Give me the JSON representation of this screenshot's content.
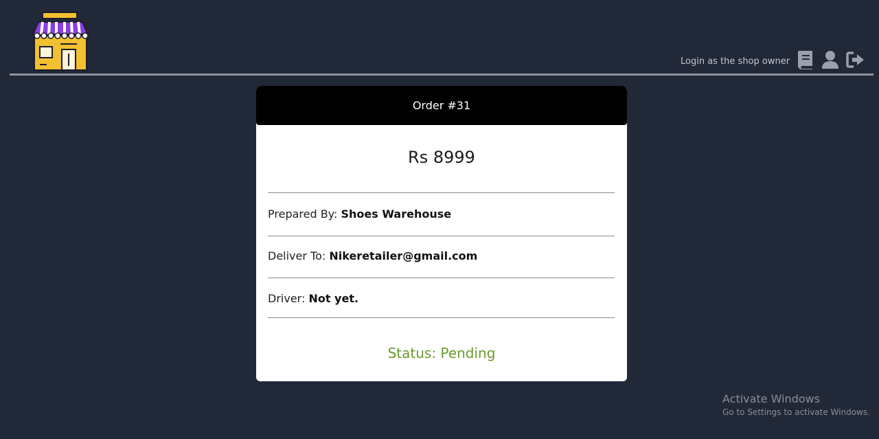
{
  "header": {
    "login_link": "Login as the shop owner",
    "icons": [
      "book-icon",
      "user-icon",
      "sign-out-icon"
    ],
    "logo": "store-logo"
  },
  "order": {
    "title": "Order #31",
    "amount": "Rs 8999",
    "prepared_by_label": "Prepared By:",
    "prepared_by_value": "Shoes Warehouse",
    "deliver_to_label": "Deliver To:",
    "deliver_to_value": "Nikeretailer@gmail.com",
    "driver_label": "Driver:",
    "driver_value": "Not yet.",
    "status": "Status: Pending"
  },
  "watermark": {
    "title": "Activate Windows",
    "subtitle": "Go to Settings to activate Windows."
  },
  "colors": {
    "background": "#212838",
    "card_header": "#000000",
    "status_green": "#6a9a2c",
    "logo_yellow": "#f3c12f",
    "logo_purple": "#8a3fe0"
  }
}
